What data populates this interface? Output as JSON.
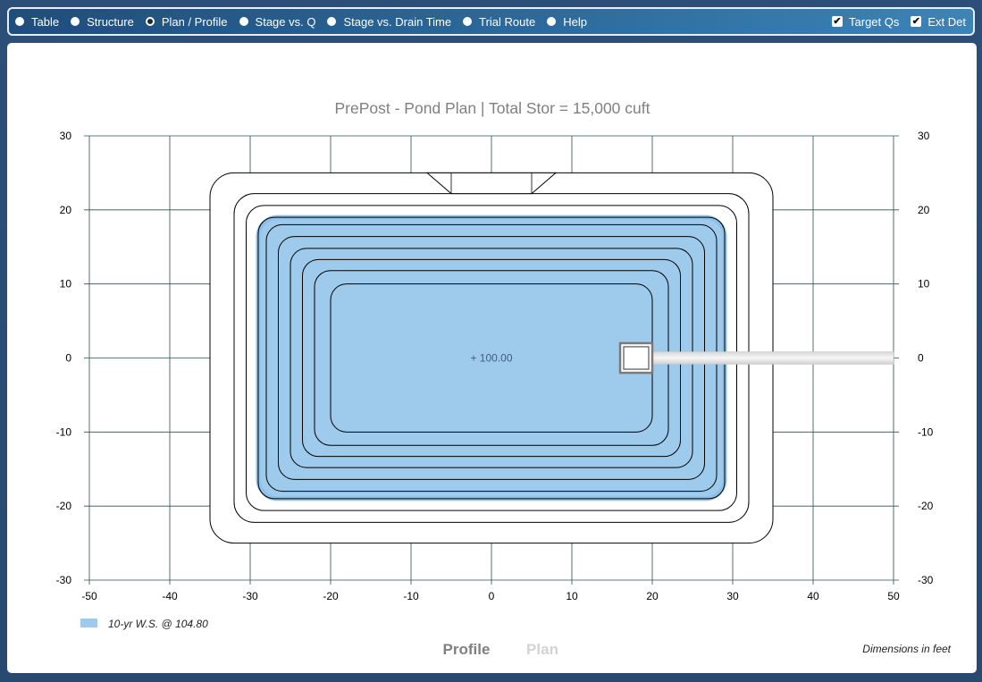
{
  "nav": {
    "radios": [
      {
        "label": "Table",
        "selected": false
      },
      {
        "label": "Structure",
        "selected": false
      },
      {
        "label": "Plan / Profile",
        "selected": true
      },
      {
        "label": "Stage vs. Q",
        "selected": false
      },
      {
        "label": "Stage vs. Drain Time",
        "selected": false
      },
      {
        "label": "Trial Route",
        "selected": false
      },
      {
        "label": "Help",
        "selected": false
      }
    ],
    "checks": [
      {
        "label": "Target Qs",
        "checked": true,
        "mark": "✔"
      },
      {
        "label": "Ext Det",
        "checked": true,
        "mark": "✔"
      }
    ]
  },
  "chart_data": {
    "type": "plan",
    "title": "PrePost - Pond Plan | Total Stor = 15,000 cuft",
    "x_ticks": [
      "-50",
      "-40",
      "-30",
      "-20",
      "-10",
      "0",
      "10",
      "20",
      "30",
      "40",
      "50"
    ],
    "y_ticks": [
      "30",
      "20",
      "10",
      "0",
      "-10",
      "-20",
      "-30"
    ],
    "xlim": [
      -50,
      50
    ],
    "ylim": [
      -30,
      30
    ],
    "grid": true,
    "water_surface": {
      "label": "10-yr W.S. @ 104.80",
      "color": "#9ecaec",
      "stroke": "#8ec0e8",
      "bounds": [
        -29,
        29,
        -19,
        19
      ]
    },
    "center_label": "+ 100.00",
    "contours": [
      {
        "bounds": [
          -35,
          35,
          -25,
          25
        ],
        "r": 3
      },
      {
        "bounds": [
          -32,
          32,
          -22.2,
          22.2
        ],
        "r": 2.5
      },
      {
        "bounds": [
          -30.5,
          30.5,
          -20.6,
          20.6
        ],
        "r": 2.2
      },
      {
        "bounds": [
          -29,
          29,
          -19,
          19
        ],
        "r": 2
      },
      {
        "bounds": [
          -28,
          28,
          -18,
          18
        ],
        "r": 2
      },
      {
        "bounds": [
          -26.5,
          26.5,
          -16.4,
          16.4
        ],
        "r": 2
      },
      {
        "bounds": [
          -25,
          25,
          -14.8,
          14.8
        ],
        "r": 2
      },
      {
        "bounds": [
          -23.5,
          23.5,
          -13.3,
          13.3
        ],
        "r": 2
      },
      {
        "bounds": [
          -22,
          22,
          -11.8,
          11.8
        ],
        "r": 2
      },
      {
        "bounds": [
          -20,
          20,
          -10,
          10
        ],
        "r": 2
      }
    ],
    "spillway": {
      "x_top": [
        -8,
        8
      ],
      "x_bottom": [
        -5,
        5
      ],
      "y_top": 25,
      "y_bottom": 22.2
    },
    "outlet_structure": {
      "center": [
        18,
        0
      ],
      "size": 4,
      "pipe_to_x": 50
    },
    "buttons": {
      "profile": "Profile",
      "plan": "Plan"
    },
    "note": "Dimensions in feet"
  }
}
